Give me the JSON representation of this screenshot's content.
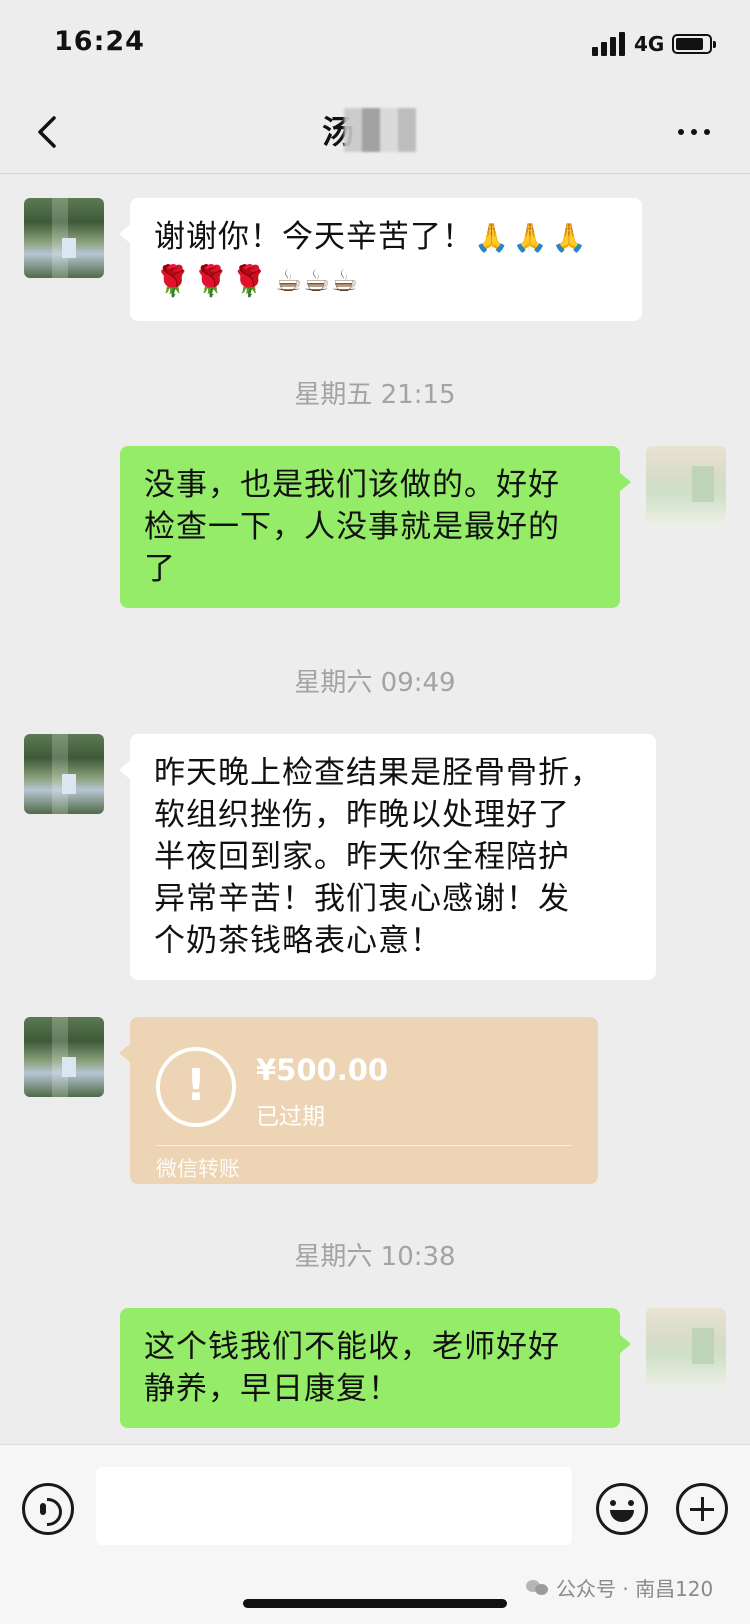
{
  "status_bar": {
    "time": "16:24",
    "network": "4G",
    "battery_level": 0.85
  },
  "nav": {
    "title": "汤",
    "back_icon": "chevron-left-icon",
    "more_icon": "ellipsis-icon"
  },
  "messages": [
    {
      "side": "left",
      "text": "谢谢你！今天辛苦了！",
      "emojis_hands": "🙏🙏🙏",
      "emojis_roses": "🌹🌹🌹",
      "emojis_cups": "☕☕☕"
    },
    {
      "timestamp": "星期五 21:15"
    },
    {
      "side": "right",
      "text_lines": [
        "没事，也是我们该做的。好好",
        "检查一下，人没事就是最好的",
        "了"
      ]
    },
    {
      "timestamp": "星期六 09:49"
    },
    {
      "side": "left",
      "text_lines": [
        "昨天晚上检查结果是胫骨骨折，",
        "软组织挫伤，昨晚以处理好了",
        "半夜回到家。昨天你全程陪护",
        "异常辛苦！我们衷心感谢！发",
        "个奶茶钱略表心意！"
      ]
    },
    {
      "side": "left",
      "type": "transfer",
      "amount": "¥500.00",
      "status": "已过期",
      "label": "微信转账"
    },
    {
      "timestamp": "星期六 10:38"
    },
    {
      "side": "right",
      "text_lines": [
        "这个钱我们不能收，老师好好",
        "静养，早日康复！"
      ]
    }
  ],
  "input_bar": {
    "value": "",
    "watermark": "公众号 · 南昌120"
  },
  "colors": {
    "background": "#ededed",
    "bubble_green": "#95ec69",
    "bubble_white": "#ffffff",
    "transfer": "#ecd4b4"
  }
}
